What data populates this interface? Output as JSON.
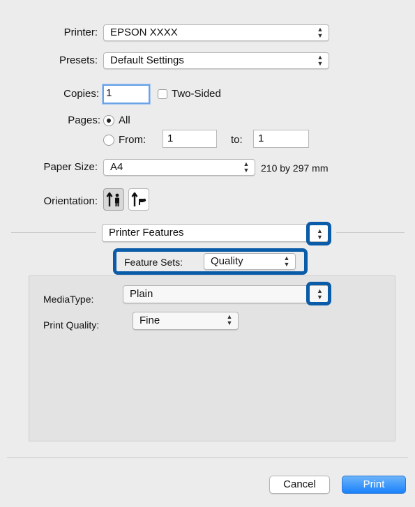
{
  "printer": {
    "label": "Printer:",
    "value": "EPSON XXXX"
  },
  "presets": {
    "label": "Presets:",
    "value": "Default Settings"
  },
  "copies": {
    "label": "Copies:",
    "value": "1",
    "two_sided_label": "Two-Sided"
  },
  "pages": {
    "label": "Pages:",
    "all_label": "All",
    "from_label": "From:",
    "from_value": "1",
    "to_label": "to:",
    "to_value": "1"
  },
  "paper_size": {
    "label": "Paper Size:",
    "value": "A4",
    "dimensions": "210 by 297 mm"
  },
  "orientation": {
    "label": "Orientation:"
  },
  "section_popup": {
    "value": "Printer Features"
  },
  "feature_sets": {
    "label": "Feature Sets:",
    "value": "Quality"
  },
  "media_type": {
    "label": "MediaType:",
    "value": "Plain"
  },
  "print_quality": {
    "label": "Print Quality:",
    "value": "Fine"
  },
  "buttons": {
    "cancel": "Cancel",
    "print": "Print"
  },
  "colors": {
    "highlight": "#0a5ca8",
    "print_button": "#1a82fb",
    "background": "#ececec"
  }
}
